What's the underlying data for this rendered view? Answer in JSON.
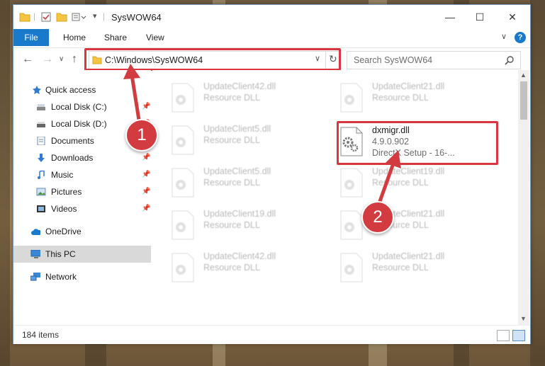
{
  "window": {
    "title": "SysWOW64",
    "controls": {
      "minimize": "—",
      "maximize": "☐",
      "close": "✕"
    }
  },
  "ribbon": {
    "tabs": [
      "File",
      "Home",
      "Share",
      "View"
    ],
    "help": "?"
  },
  "address": {
    "path": "C:\\Windows\\SysWOW64",
    "search_placeholder": "Search SysWOW64"
  },
  "sidebar": {
    "items": [
      {
        "label": "Quick access",
        "icon": "star-icon",
        "pinned": false
      },
      {
        "label": "Local Disk (C:)",
        "icon": "drive-icon",
        "pinned": true
      },
      {
        "label": "Local Disk (D:)",
        "icon": "drive-icon",
        "pinned": true
      },
      {
        "label": "Documents",
        "icon": "documents-icon",
        "pinned": true
      },
      {
        "label": "Downloads",
        "icon": "download-icon",
        "pinned": true
      },
      {
        "label": "Music",
        "icon": "music-icon",
        "pinned": true
      },
      {
        "label": "Pictures",
        "icon": "pictures-icon",
        "pinned": true
      },
      {
        "label": "Videos",
        "icon": "videos-icon",
        "pinned": true
      },
      {
        "label": "OneDrive",
        "icon": "cloud-icon",
        "pinned": false
      },
      {
        "label": "This PC",
        "icon": "computer-icon",
        "pinned": false,
        "selected": true
      },
      {
        "label": "Network",
        "icon": "network-icon",
        "pinned": false
      }
    ]
  },
  "files": [
    {
      "name": "UpdateClient42.dll",
      "desc": "Resource DLL",
      "highlight": false
    },
    {
      "name": "UpdateClient21.dll",
      "desc": "Resource DLL",
      "highlight": false
    },
    {
      "name": "UpdateClient5.dll",
      "desc": "Resource DLL",
      "highlight": false
    },
    {
      "name": "dxmigr.dll",
      "desc": "4.9.0.902",
      "desc2": "DirectX Setup - 16-...",
      "highlight": true
    },
    {
      "name": "UpdateClient5.dll",
      "desc": "Resource DLL",
      "highlight": false
    },
    {
      "name": "UpdateClient19.dll",
      "desc": "Resource DLL",
      "highlight": false
    },
    {
      "name": "UpdateClient19.dll",
      "desc": "Resource DLL",
      "highlight": false
    },
    {
      "name": "UpdateClient21.dll",
      "desc": "Resource DLL",
      "highlight": false
    },
    {
      "name": "UpdateClient42.dll",
      "desc": "Resource DLL",
      "highlight": false
    },
    {
      "name": "UpdateClient21.dll",
      "desc": "Resource DLL",
      "highlight": false
    }
  ],
  "status": {
    "items": "184 items"
  },
  "callouts": [
    "1",
    "2"
  ],
  "colors": {
    "accent": "#1979ca",
    "callout": "#d23b3f",
    "selection": "#d9d9d9"
  }
}
